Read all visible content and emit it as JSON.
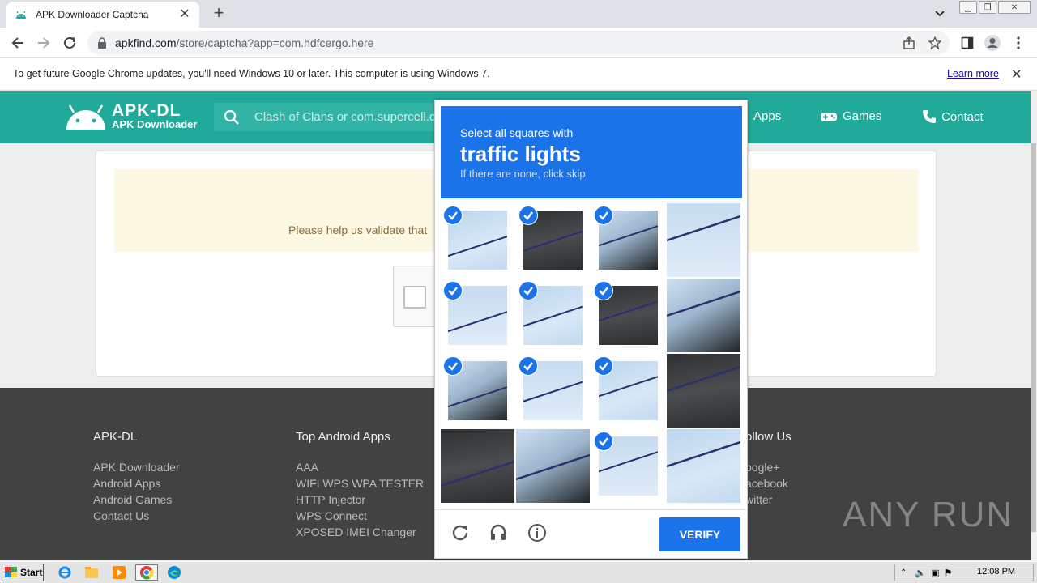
{
  "browser": {
    "tab_title": "APK Downloader Captcha",
    "url_host": "apkfind.com",
    "url_path": "/store/captcha?app=com.hdfcergo.here",
    "infobar_message": "To get future Google Chrome updates, you'll need Windows 10 or later. This computer is using Windows 7.",
    "infobar_link": "Learn more"
  },
  "site": {
    "brand": "APK-DL",
    "tagline": "APK Downloader",
    "search_placeholder": "Clash of Clans or com.supercell.c",
    "nav": [
      {
        "label": "Apps",
        "icon": "android-icon"
      },
      {
        "label": "Games",
        "icon": "gamepad-icon"
      },
      {
        "label": "Contact",
        "icon": "phone-icon"
      }
    ],
    "notice_text": "Please help us validate that"
  },
  "footer": {
    "col1": {
      "title": "APK-DL",
      "links": [
        "APK Downloader",
        "Android Apps",
        "Android Games",
        "Contact Us"
      ]
    },
    "col2": {
      "title": "Top Android Apps",
      "links": [
        "AAA",
        "WIFI WPS WPA TESTER",
        "HTTP Injector",
        "WPS Connect",
        "XPOSED IMEI Changer"
      ]
    },
    "col3": {
      "title": "ollow Us",
      "links": [
        "oogle+",
        "acebook",
        "witter"
      ]
    },
    "watermark": "ANY RUN"
  },
  "captcha": {
    "instruction": "Select all squares with",
    "target": "traffic lights",
    "hint": "If there are none, click skip",
    "verify_label": "VERIFY",
    "tiles_selected": [
      true,
      true,
      true,
      false,
      true,
      true,
      true,
      false,
      true,
      true,
      true,
      false,
      false,
      false,
      true,
      false
    ],
    "colors": {
      "accent": "#1a73e8"
    }
  },
  "taskbar": {
    "start_label": "Start",
    "clock": "12:08 PM"
  },
  "colors": {
    "site_header": "#21a99a",
    "footer": "#424242",
    "notice_bg": "#fcf8e3",
    "notice_text": "#8a6d3b"
  }
}
